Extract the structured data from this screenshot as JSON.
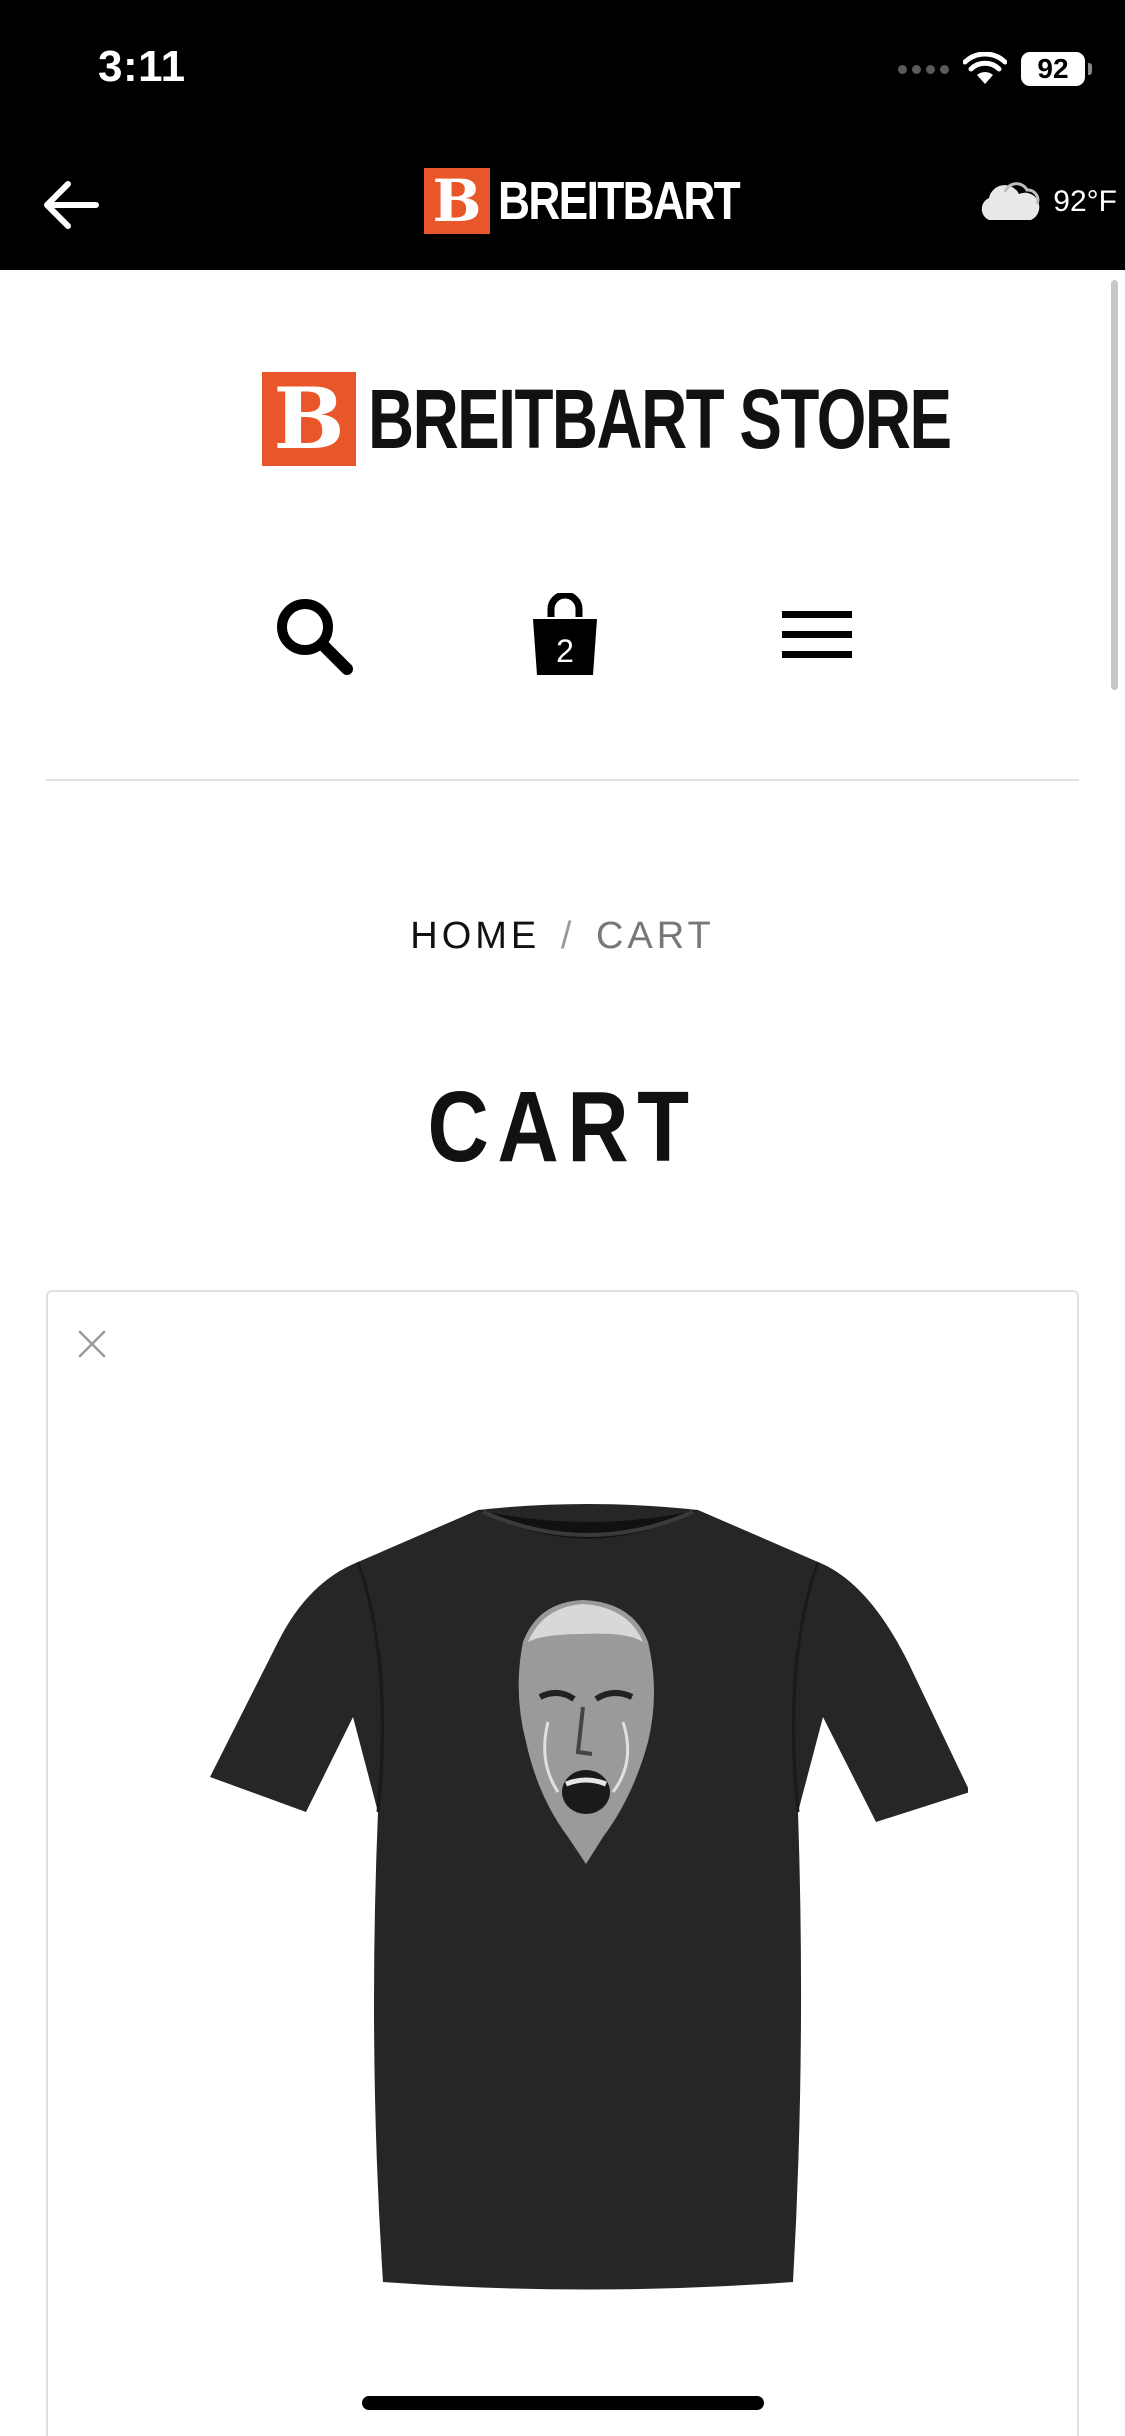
{
  "status_bar": {
    "time": "3:11",
    "battery": "92"
  },
  "app_bar": {
    "brand_name": "BREITBART",
    "brand_letter": "B",
    "temperature": "92°F"
  },
  "store": {
    "name": "BREITBART STORE",
    "logo_letter": "B",
    "cart_count": "2"
  },
  "breadcrumb": {
    "home": "HOME",
    "separator": "/",
    "current": "CART"
  },
  "page": {
    "title": "CART"
  },
  "colors": {
    "brand_orange": "#e8562a",
    "bar_black": "#000000",
    "text_dark": "#111111"
  },
  "icons": [
    "back-arrow-icon",
    "cloud-icon",
    "wifi-icon",
    "search-icon",
    "shopping-bag-icon",
    "menu-icon",
    "close-icon"
  ]
}
